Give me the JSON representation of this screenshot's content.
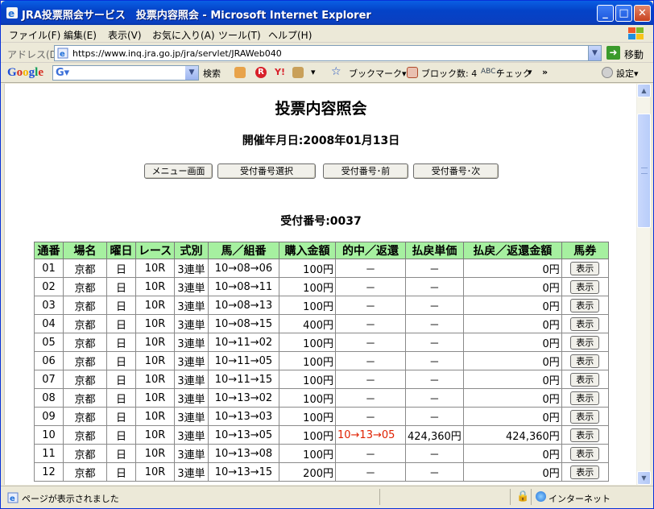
{
  "window": {
    "title": "JRA投票照会サービス　投票内容照会 - Microsoft Internet Explorer",
    "minimize": "_",
    "maximize": "□",
    "close": "✕"
  },
  "menu": [
    "ファイル(F)",
    "編集(E)",
    "表示(V)",
    "お気に入り(A)",
    "ツール(T)",
    "ヘルプ(H)"
  ],
  "address": {
    "label": "アドレス(D)",
    "url": "https://www.inq.jra.go.jp/jra/servlet/JRAWeb040",
    "go_label": "移動"
  },
  "google_toolbar": {
    "logo": "Google",
    "search_label": "検索",
    "bookmarks_label": "ブックマーク▾",
    "blocked_label": "ブロック数: 4",
    "check_label": "チェック",
    "more": "»",
    "settings_label": "設定▾"
  },
  "page": {
    "title": "投票内容照会",
    "date_line": "開催年月日:2008年01月13日",
    "buttons": [
      "メニュー画面",
      "受付番号選択",
      "受付番号･前",
      "受付番号･次"
    ],
    "receipt_line": "受付番号:0037"
  },
  "table": {
    "headers": [
      "通番",
      "場名",
      "曜日",
      "レース",
      "式別",
      "馬／組番",
      "購入金額",
      "的中／返還",
      "払戻単価",
      "払戻／返還金額",
      "馬券"
    ],
    "rows": [
      [
        "01",
        "京都",
        "日",
        "10R",
        "3連単",
        "10→08→06",
        "100円",
        "－",
        "－",
        "0円",
        "表示"
      ],
      [
        "02",
        "京都",
        "日",
        "10R",
        "3連単",
        "10→08→11",
        "100円",
        "－",
        "－",
        "0円",
        "表示"
      ],
      [
        "03",
        "京都",
        "日",
        "10R",
        "3連単",
        "10→08→13",
        "100円",
        "－",
        "－",
        "0円",
        "表示"
      ],
      [
        "04",
        "京都",
        "日",
        "10R",
        "3連単",
        "10→08→15",
        "400円",
        "－",
        "－",
        "0円",
        "表示"
      ],
      [
        "05",
        "京都",
        "日",
        "10R",
        "3連単",
        "10→11→02",
        "100円",
        "－",
        "－",
        "0円",
        "表示"
      ],
      [
        "06",
        "京都",
        "日",
        "10R",
        "3連単",
        "10→11→05",
        "100円",
        "－",
        "－",
        "0円",
        "表示"
      ],
      [
        "07",
        "京都",
        "日",
        "10R",
        "3連単",
        "10→11→15",
        "100円",
        "－",
        "－",
        "0円",
        "表示"
      ],
      [
        "08",
        "京都",
        "日",
        "10R",
        "3連単",
        "10→13→02",
        "100円",
        "－",
        "－",
        "0円",
        "表示"
      ],
      [
        "09",
        "京都",
        "日",
        "10R",
        "3連単",
        "10→13→03",
        "100円",
        "－",
        "－",
        "0円",
        "表示"
      ],
      [
        "10",
        "京都",
        "日",
        "10R",
        "3連単",
        "10→13→05",
        "100円",
        "10→13→05",
        "424,360円",
        "424,360円",
        "表示"
      ],
      [
        "11",
        "京都",
        "日",
        "10R",
        "3連単",
        "10→13→08",
        "100円",
        "－",
        "－",
        "0円",
        "表示"
      ],
      [
        "12",
        "京都",
        "日",
        "10R",
        "3連単",
        "10→13→15",
        "200円",
        "－",
        "－",
        "0円",
        "表示"
      ]
    ],
    "hit_color": "#e02000",
    "header_color": "#a6f0a0"
  },
  "status": {
    "text": "ページが表示されました",
    "zone": "インターネット"
  }
}
